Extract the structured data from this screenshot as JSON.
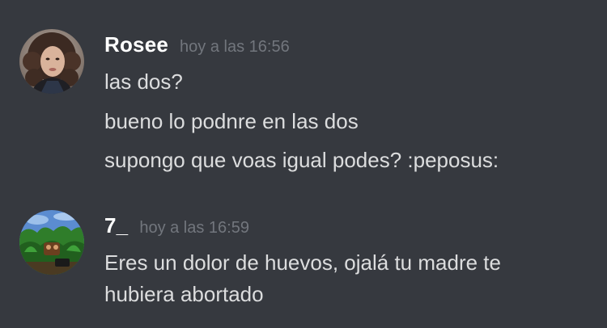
{
  "messages": [
    {
      "username": "Rosee",
      "timestamp": "hoy a las 16:56",
      "lines": [
        "las dos?",
        "bueno lo podnre en las dos",
        "supongo que voas igual podes? :peposus:"
      ]
    },
    {
      "username": "7_",
      "timestamp": "hoy a las 16:59",
      "lines": [
        "Eres un dolor de huevos, ojalá tu madre te",
        "hubiera abortado"
      ]
    }
  ],
  "colors": {
    "background": "#36393f",
    "username": "#ffffff",
    "timestamp": "#72767d",
    "message_text": "#dcddde"
  }
}
